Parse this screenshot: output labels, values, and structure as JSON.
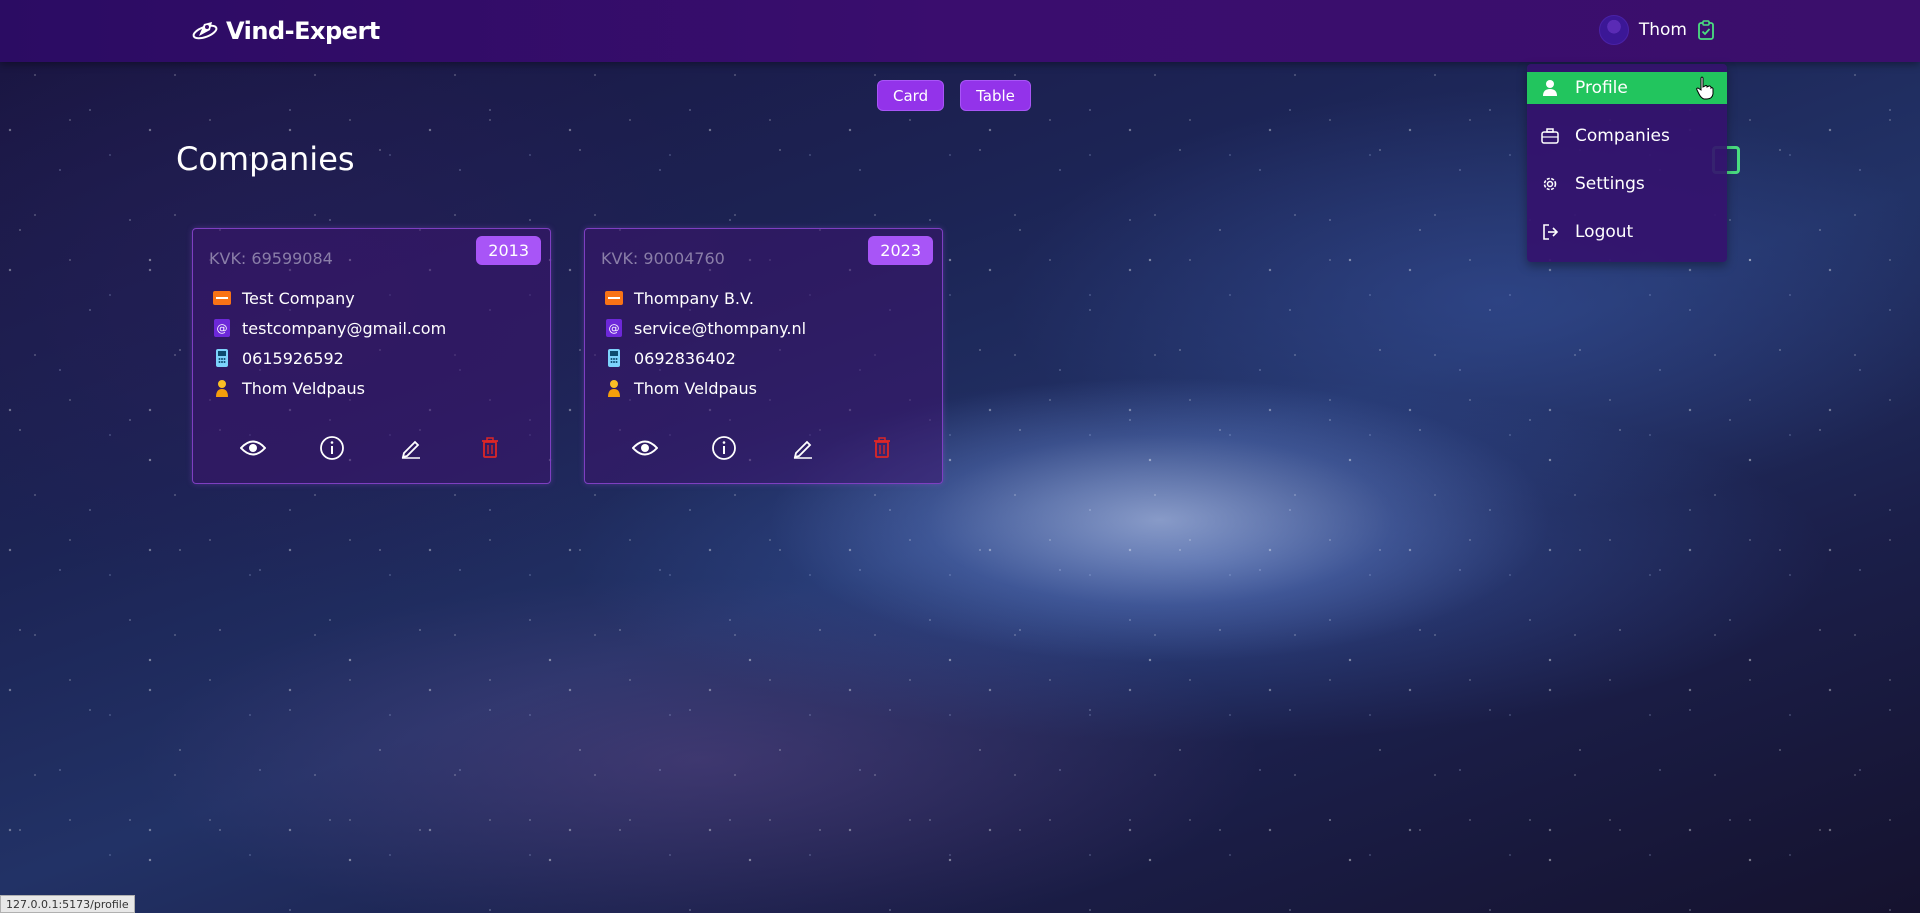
{
  "navbar": {
    "brand": "Vind-Expert",
    "brand_icon": "rocket-logo-icon",
    "user_name": "Thom",
    "user_icon": "clipboard-check-icon"
  },
  "view_toggle": {
    "card_label": "Card",
    "table_label": "Table"
  },
  "page": {
    "title": "Companies"
  },
  "companies": [
    {
      "kvk": "KVK: 69599084",
      "year": "2013",
      "name": "Test Company",
      "email": "testcompany@gmail.com",
      "phone": "0615926592",
      "contact": "Thom Veldpaus"
    },
    {
      "kvk": "KVK: 90004760",
      "year": "2023",
      "name": "Thompany B.V.",
      "email": "service@thompany.nl",
      "phone": "0692836402",
      "contact": "Thom Veldpaus"
    }
  ],
  "dropdown": {
    "items": [
      {
        "label": "Profile",
        "icon": "user-icon",
        "active": true
      },
      {
        "label": "Companies",
        "icon": "briefcase-icon",
        "active": false
      },
      {
        "label": "Settings",
        "icon": "gear-icon",
        "active": false
      },
      {
        "label": "Logout",
        "icon": "logout-icon",
        "active": false
      }
    ]
  },
  "status_bar": {
    "url": "127.0.0.1:5173/profile"
  },
  "colors": {
    "navbar": "#3a0d6e",
    "accent_purple": "#9333ea",
    "badge_purple": "#a855f7",
    "active_green": "#22c55e",
    "delete_red": "#dc2626"
  }
}
